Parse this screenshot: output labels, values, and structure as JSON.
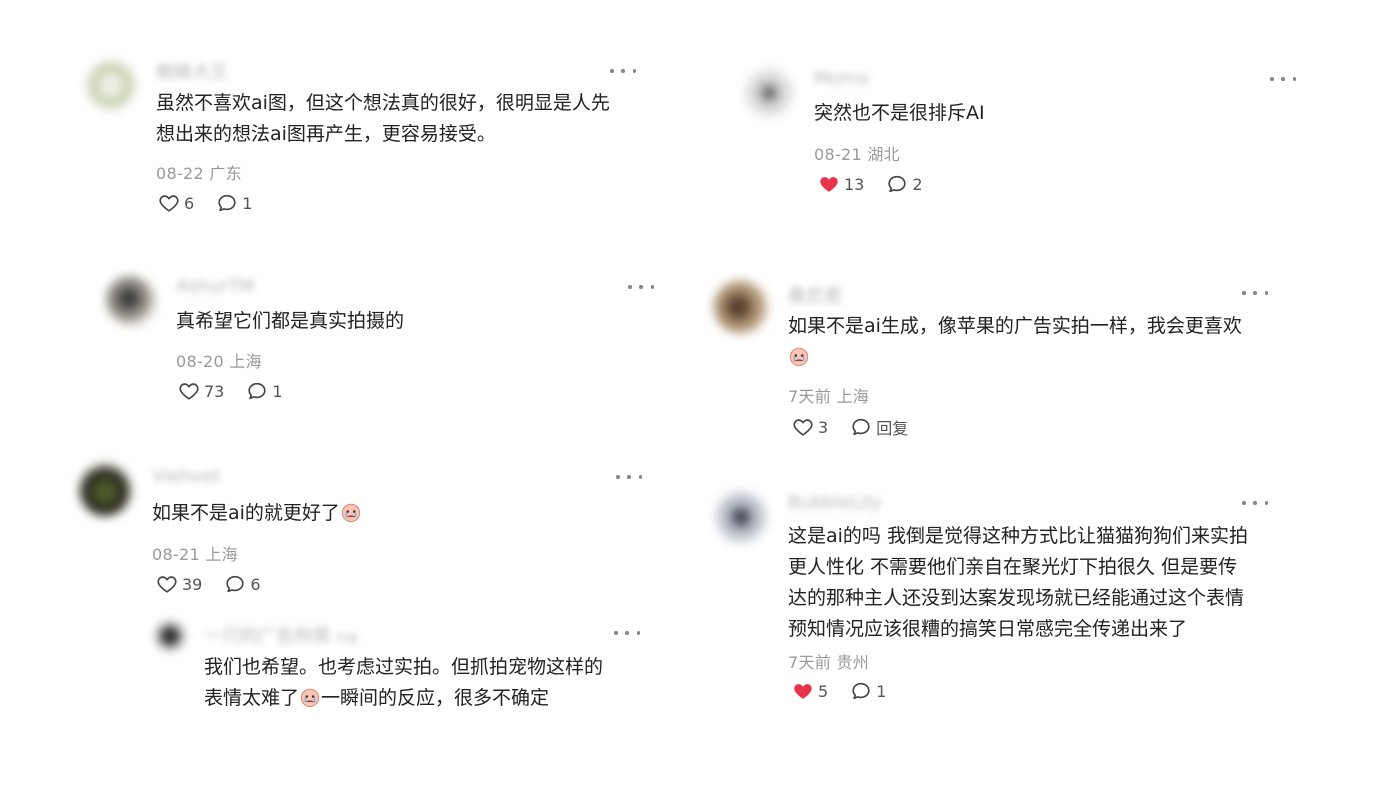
{
  "comments": [
    {
      "username": "蜘蛛大王",
      "text_lines": [
        "虽然不喜欢ai图，但这个想法真的很好，很明显是人先",
        "想出来的想法ai图再产生，更容易接受。"
      ],
      "date_location": "08-22 广东",
      "likes": "6",
      "replies": "1",
      "liked": false
    },
    {
      "username": "AshurTM",
      "text_lines": [
        "真希望它们都是真实拍摄的"
      ],
      "date_location": "08-20 上海",
      "likes": "73",
      "replies": "1",
      "liked": false
    },
    {
      "username": "Viehvet",
      "text_lines": [
        "如果不是ai的就更好了"
      ],
      "date_location": "08-21 上海",
      "likes": "39",
      "replies": "6",
      "liked": false
    },
    {
      "username": "一只的广告热情",
      "author_badge": "作者",
      "text_lines": [
        "我们也希望。也考虑过实拍。但抓拍宠物这样的",
        "表情太难了",
        "一瞬间的反应，很多不确定"
      ]
    },
    {
      "username": "Momo",
      "text_lines": [
        "突然也不是很排斥AI"
      ],
      "date_location": "08-21 湖北",
      "likes": "13",
      "replies": "2",
      "liked": true
    },
    {
      "username": "桑尼君",
      "text_lines": [
        "如果不是ai生成，像苹果的广告实拍一样，我会更喜欢"
      ],
      "date_location": "7天前 上海",
      "likes": "3",
      "replies": "回复",
      "liked": false
    },
    {
      "username": "BubbleLily",
      "text_lines": [
        "这是ai的吗 我倒是觉得这种方式比让猫猫狗狗们来实拍",
        "更人性化 不需要他们亲自在聚光灯下拍很久 但是要传",
        "达的那种主人还没到达案发现场就已经能通过这个表情",
        "预知情况应该很糟的搞笑日常感完全传递出来了"
      ],
      "date_location": "7天前 贵州",
      "likes": "5",
      "replies": "1",
      "liked": true
    }
  ],
  "icons": {
    "like": "heart-outline-icon",
    "liked": "heart-filled-icon",
    "reply": "speech-bubble-icon",
    "more": "more-dots-icon",
    "emoji": "crying-face-emoji"
  },
  "colors": {
    "liked_red": "#e8344a",
    "meta_gray": "#9a9a9a"
  }
}
